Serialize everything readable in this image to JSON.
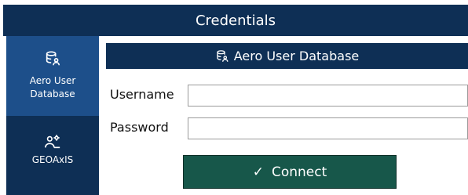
{
  "window": {
    "title": "Credentials"
  },
  "sidebar": {
    "items": [
      {
        "label": "Aero User Database",
        "icon": "database-user-icon",
        "selected": true
      },
      {
        "label": "GEOAxIS",
        "icon": "users-gear-icon",
        "selected": false
      }
    ]
  },
  "main": {
    "header_title": "Aero User Database",
    "header_icon": "database-user-icon",
    "username_label": "Username",
    "username_value": "",
    "password_label": "Password",
    "password_value": "",
    "connect_label": "Connect",
    "connect_icon": "check-icon"
  },
  "colors": {
    "navy": "#0e2f55",
    "selected_nav": "#1d4f8a",
    "connect_green": "#17574a"
  }
}
